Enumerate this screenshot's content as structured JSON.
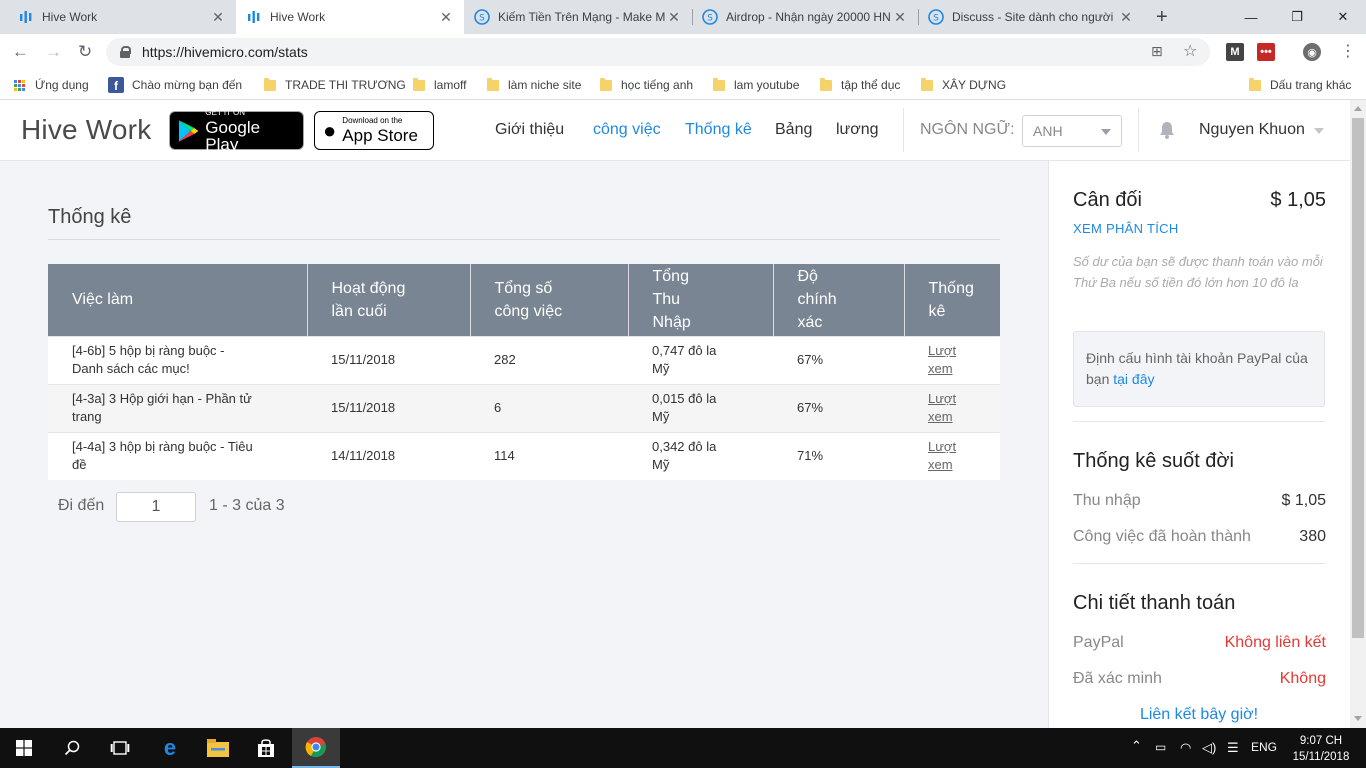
{
  "browser": {
    "tabs": [
      {
        "title": "Hive Work",
        "active": false,
        "icon": "hive-icon"
      },
      {
        "title": "Hive Work",
        "active": true,
        "icon": "hive-icon"
      },
      {
        "title": "Kiếm Tiền Trên Mạng - Make M",
        "active": false,
        "icon": "steemit-icon"
      },
      {
        "title": "Airdrop - Nhận ngày 20000 HN",
        "active": false,
        "icon": "steemit-icon"
      },
      {
        "title": "Discuss - Site dành cho người",
        "active": false,
        "icon": "steemit-icon"
      }
    ],
    "url": "https://hivemicro.com/stats",
    "bookmarks": [
      {
        "label": "Ứng dụng",
        "icon": "apps-grid-icon"
      },
      {
        "label": "Chào mừng bạn đến",
        "icon": "facebook-icon"
      },
      {
        "label": "TRADE THI TRƯƠNG",
        "icon": "folder-icon"
      },
      {
        "label": "lamoff",
        "icon": "folder-icon"
      },
      {
        "label": "làm niche site",
        "icon": "folder-icon"
      },
      {
        "label": "học tiếng anh",
        "icon": "folder-icon"
      },
      {
        "label": "lam youtube",
        "icon": "folder-icon"
      },
      {
        "label": "tập thể dục",
        "icon": "folder-icon"
      },
      {
        "label": "XÂY DỰNG",
        "icon": "folder-icon"
      },
      {
        "label": "Dấu trang khác",
        "icon": "folder-icon"
      }
    ]
  },
  "header": {
    "brand": "Hive Work",
    "google_play": {
      "small": "GET IT ON",
      "big": "Google Play"
    },
    "app_store": {
      "small": "Download on the",
      "big": "App Store"
    },
    "nav": [
      "Giới thiệu",
      "công việc",
      "Thống kê",
      "Bảng",
      "lương"
    ],
    "language_label": "NGÔN NGỮ:",
    "language_value": "ANH",
    "user_name": "Nguyen Khuon"
  },
  "main": {
    "title": "Thống kê",
    "columns": [
      [
        "Việc làm"
      ],
      [
        "Hoạt động",
        "lần cuối"
      ],
      [
        "Tổng số",
        "công việc"
      ],
      [
        "Tổng",
        "Thu",
        "Nhập"
      ],
      [
        "Độ",
        "chính",
        "xác"
      ],
      [
        "Thống",
        "kê"
      ]
    ],
    "rows": [
      {
        "job": [
          "[4-6b] 5 hộp bị ràng buộc -",
          "Danh sách các mục!"
        ],
        "last_active": "15/11/2018",
        "total": "282",
        "earnings": [
          "0,747 đô la",
          "Mỹ"
        ],
        "accuracy": "67%",
        "link": [
          "Lượt",
          "xem"
        ]
      },
      {
        "job": [
          "[4-3a] 3 Hộp giới hạn - Phần tử",
          "trang"
        ],
        "last_active": "15/11/2018",
        "total": "6",
        "earnings": [
          "0,015 đô la",
          "Mỹ"
        ],
        "accuracy": "67%",
        "link": [
          "Lượt",
          "xem"
        ]
      },
      {
        "job": [
          "[4-4a] 3 hộp bị ràng buộc - Tiêu",
          "đề"
        ],
        "last_active": "14/11/2018",
        "total": "114",
        "earnings": [
          "0,342 đô la",
          "Mỹ"
        ],
        "accuracy": "71%",
        "link": [
          "Lượt",
          "xem"
        ]
      }
    ],
    "pager": {
      "label": "Đi đến",
      "page": "1",
      "info": "1 - 3 của 3"
    }
  },
  "sidebar": {
    "balance_title": "Cân đối",
    "balance_value": "$ 1,05",
    "analysis_link": "XEM PHÂN TÍCH",
    "note": "Số dư của bạn sẽ được thanh toán vào mỗi Thứ Ba nếu số tiền đó lớn hơn 10 đô la",
    "paypal_box_text": "Định cấu hình tài khoản PayPal của bạn",
    "paypal_box_link": "tại đây",
    "lifetime_title": "Thống kê suốt đời",
    "income_label": "Thu nhập",
    "income_value": "$ 1,05",
    "tasks_label": "Công việc đã hoàn thành",
    "tasks_value": "380",
    "payment_title": "Chi tiết thanh toán",
    "paypal_label": "PayPal",
    "paypal_value": "Không liên kết",
    "verified_label": "Đã xác minh",
    "verified_value": "Không",
    "link_now": "Liên kết bây giờ!"
  },
  "taskbar": {
    "language": "ENG",
    "time": "9:07 CH",
    "date": "15/11/2018"
  },
  "colors": {
    "accent": "#1e88e5",
    "table_header": "#7a8593",
    "danger": "#e53935",
    "page_bg": "#f2f4f7"
  }
}
